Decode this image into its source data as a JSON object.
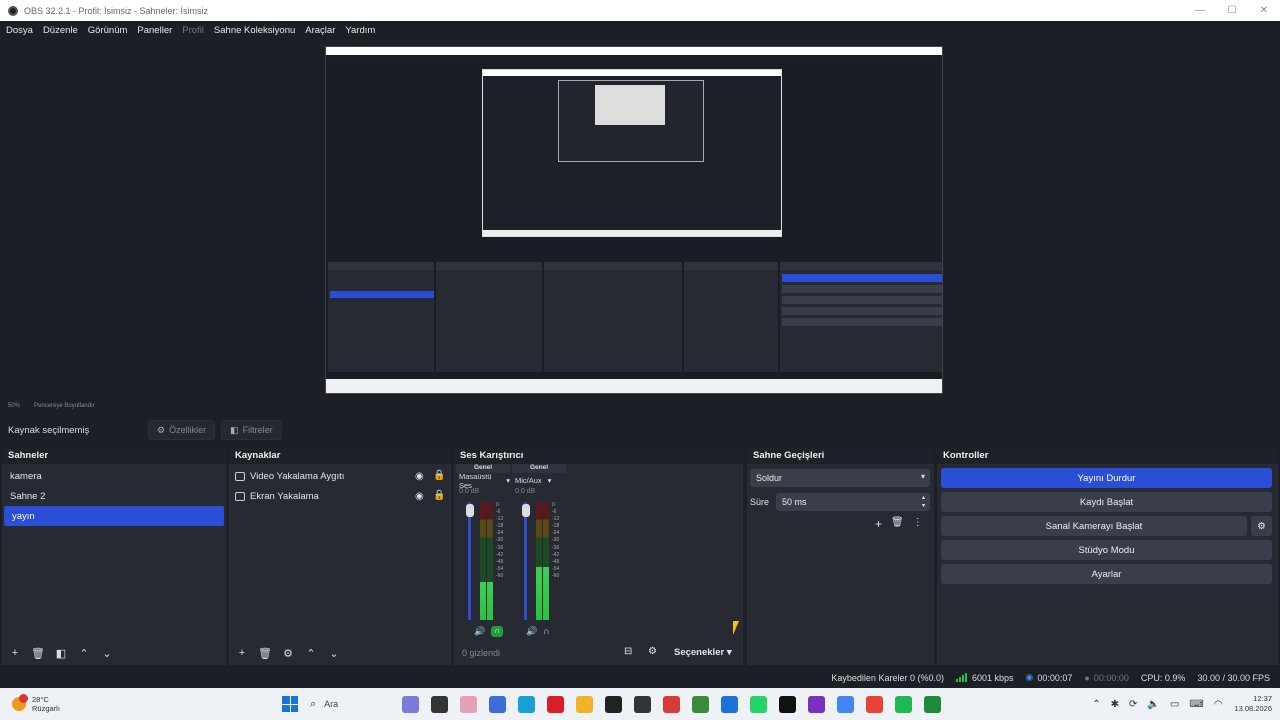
{
  "window": {
    "title": "OBS 32.2.1 - Profil: İsimsiz - Sahneler: İsimsiz",
    "minimize": "—",
    "maximize": "☐",
    "close": "✕"
  },
  "menu": [
    {
      "label": "Dosya"
    },
    {
      "label": "Düzenle"
    },
    {
      "label": "Görünüm"
    },
    {
      "label": "Paneller"
    },
    {
      "label": "Profil"
    },
    {
      "label": "Sahne Koleksiyonu"
    },
    {
      "label": "Araçlar"
    },
    {
      "label": "Yardım"
    }
  ],
  "preview": {
    "zoom": "50%",
    "fit_label": "Pencereye Boyutlandır"
  },
  "source_toolbar": {
    "no_selection": "Kaynak seçilmemiş",
    "properties": "Özellikler",
    "filters": "Filtreler"
  },
  "scenes": {
    "title": "Sahneler",
    "items": [
      "kamera",
      "Sahne 2",
      "yayın"
    ],
    "selected": "yayın"
  },
  "sources": {
    "title": "Kaynaklar",
    "items": [
      "Video Yakalama Aygıtı",
      "Ekran Yakalama"
    ]
  },
  "mixer": {
    "title": "Ses Karıştırıcı",
    "channels": [
      {
        "header": "Genel",
        "name": "Masaüstü Ses",
        "db": "0.0 dB",
        "level": 0.32
      },
      {
        "header": "Genel",
        "name": "Mic/Aux",
        "db": "0.0 dB",
        "level": 0.45
      }
    ],
    "scale": [
      "0",
      "-6",
      "-12",
      "-18",
      "-24",
      "-30",
      "-36",
      "-42",
      "-48",
      "-54",
      "-60"
    ],
    "hidden": "0 gizlendi",
    "options": "Seçenekler"
  },
  "transitions": {
    "title": "Sahne Geçişleri",
    "type": "Soldur",
    "duration_label": "Süre",
    "duration": "50 ms"
  },
  "controls": {
    "title": "Kontroller",
    "stop_stream": "Yayını Durdur",
    "start_record": "Kaydı Başlat",
    "virtual_cam": "Sanal Kamerayı Başlat",
    "studio_mode": "Stüdyo Modu",
    "settings": "Ayarlar"
  },
  "status": {
    "dropped": "Kaybedilen Kareler 0 (%0.0)",
    "bitrate": "6001 kbps",
    "stream_time": "00:00:07",
    "record_time": "00:00:00",
    "cpu": "CPU: 0.9%",
    "fps": "30.00 / 30.00 FPS"
  },
  "taskbar": {
    "weather_temp": "28°C",
    "weather_desc": "Rüzgarlı",
    "search": "Ara",
    "time": "12:37",
    "date": "13.08.2026",
    "app_colors": [
      "#7a7ad8",
      "#333333",
      "#e8a0b8",
      "#3a6fd8",
      "#1aa0d8",
      "#d81f26",
      "#f0b429",
      "#222222",
      "#333333",
      "#d83a3a",
      "#3b8a3b",
      "#1a73d9",
      "#25d366",
      "#111111",
      "#7b2fbe",
      "#4285f4",
      "#ea4335",
      "#1db954",
      "#1e8a3c"
    ]
  },
  "colors": {
    "accent": "#2a4fd6",
    "meter_green": "#26c241"
  }
}
